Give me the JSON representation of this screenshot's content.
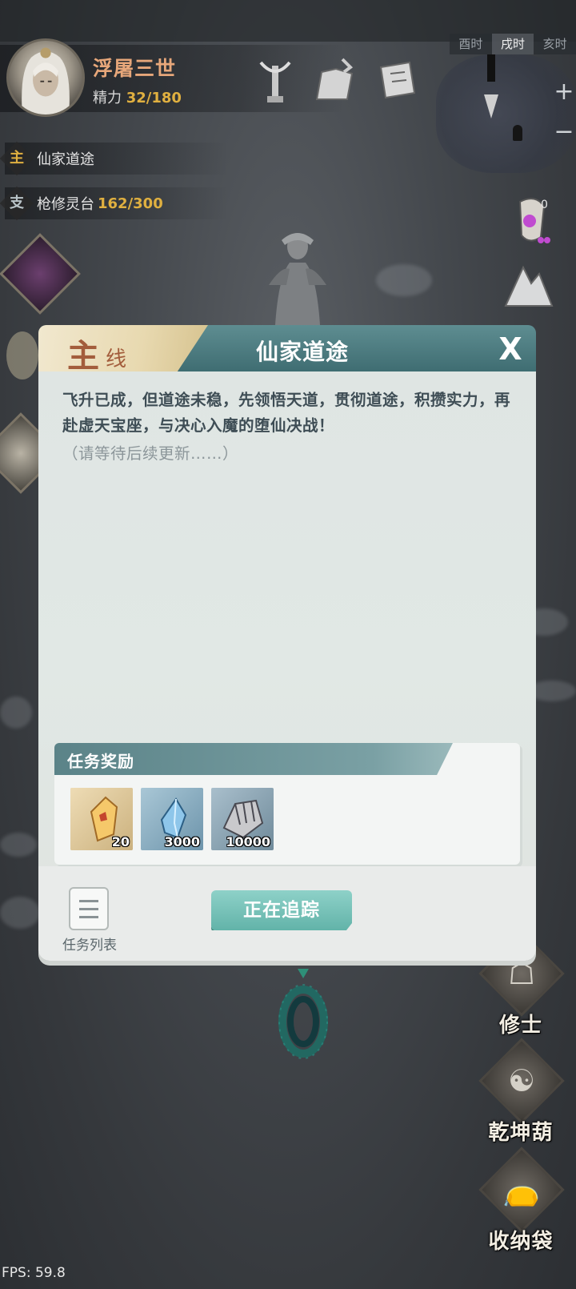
{
  "player": {
    "name": "浮屠三世",
    "energy_label": "精力",
    "energy_value": "32/180"
  },
  "time_bar": {
    "slots": [
      "酉时",
      "戌时",
      "亥时"
    ],
    "active": "戌时"
  },
  "map_controls": {
    "zoom_in": "+",
    "zoom_out": "−"
  },
  "quest_tracker": {
    "main": {
      "tag": "主",
      "title": "仙家道途"
    },
    "side": {
      "tag": "支",
      "title": "枪修灵台",
      "progress": "162/300"
    }
  },
  "right_notification": {
    "count": "0"
  },
  "right_buttons": [
    {
      "label": "修士",
      "icon": "cultivator-icon"
    },
    {
      "label": "乾坤葫",
      "icon": "gourd-icon"
    },
    {
      "label": "收纳袋",
      "icon": "bag-icon"
    }
  ],
  "dialog": {
    "tab_main": "主",
    "tab_sub": "线",
    "title": "仙家道途",
    "close": "X",
    "description": "飞升已成，但道途未稳，先领悟天道，贯彻道途，积攒实力，再赴虚天宝座，与决心入魔的堕仙决战！",
    "note": "（请等待后续更新……）",
    "reward_title": "任务奖励",
    "rewards": [
      {
        "name": "spirit-stone-gold",
        "count": "20"
      },
      {
        "name": "spirit-crystal-blue",
        "count": "3000"
      },
      {
        "name": "scroll-bundle",
        "count": "10000"
      }
    ],
    "list_label": "任务列表",
    "track_label": "正在追踪"
  },
  "fps": "FPS: 59.8",
  "colors": {
    "accent_teal": "#62b3a9",
    "header_teal": "#3f6d72",
    "gold": "#e0b040",
    "name_orange": "#e7a77a"
  }
}
